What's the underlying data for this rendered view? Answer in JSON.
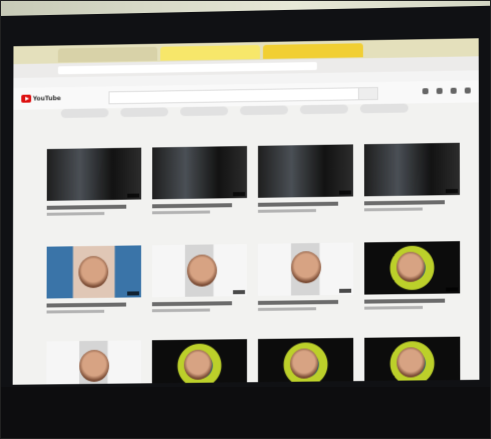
{
  "scene": {
    "subject": "",
    "browser_tabs": [
      "",
      "",
      ""
    ],
    "site": {
      "logo_text": "YouTube",
      "search_placeholder": "",
      "filter_chips": [
        "",
        "",
        "",
        "",
        "",
        ""
      ]
    }
  },
  "colors": {
    "youtube_red": "#dd1111",
    "browser_tab_yellow": "#f1cf33",
    "monitor_black": "#101114",
    "thumbnail_frame_green": "#bcd02a"
  }
}
